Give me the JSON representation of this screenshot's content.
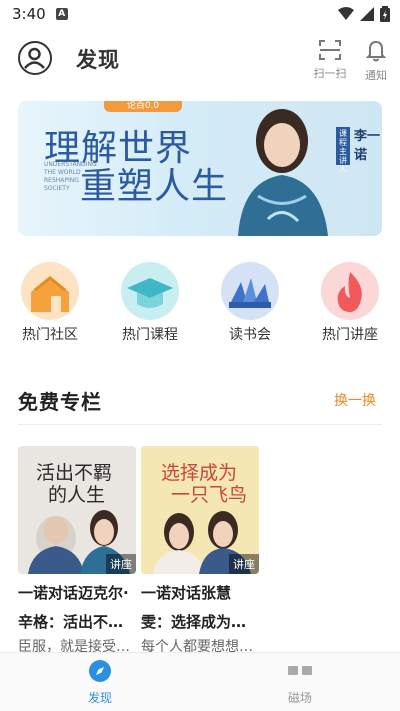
{
  "status_bar": {
    "time": "3:40",
    "notif_letter": "A"
  },
  "header": {
    "title": "发现",
    "scan_label": "扫一扫",
    "notify_label": "通知"
  },
  "banner": {
    "tag": "论百0.0",
    "headline_1": "理解世界",
    "headline_2": "重塑人生",
    "english_text": "UNDERSTANDING THE WORLD RESHAPING SOCIETY",
    "host_tag": "课程主讲人",
    "host_name": "李一诺"
  },
  "categories": [
    {
      "label": "热门社区",
      "icon": "house-icon",
      "color": "#f6a23c"
    },
    {
      "label": "热门课程",
      "icon": "graduation-cap-icon",
      "color": "#3fb7c4"
    },
    {
      "label": "读书会",
      "icon": "books-icon",
      "color": "#3f72c8"
    },
    {
      "label": "热门讲座",
      "icon": "flame-icon",
      "color": "#f05a5a"
    }
  ],
  "free_column": {
    "title": "免费专栏",
    "refresh_label": "换一换",
    "cards": [
      {
        "cover_text_1": "活出不羁",
        "cover_text_2": "的人生",
        "tag": "讲座",
        "title": "一诺对话迈克尔·",
        "line2": "辛格：活出不…",
        "line3": "臣服，就是接受…"
      },
      {
        "cover_text_1": "选择成为",
        "cover_text_2": "一只飞鸟",
        "tag": "讲座",
        "title": "一诺对话张慧",
        "line2": "雯：选择成为…",
        "line3": "每个人都要想想…"
      }
    ]
  },
  "bottom_nav": {
    "discover_label": "发现",
    "field_label": "磁场",
    "active_color": "#2d8fe0"
  }
}
